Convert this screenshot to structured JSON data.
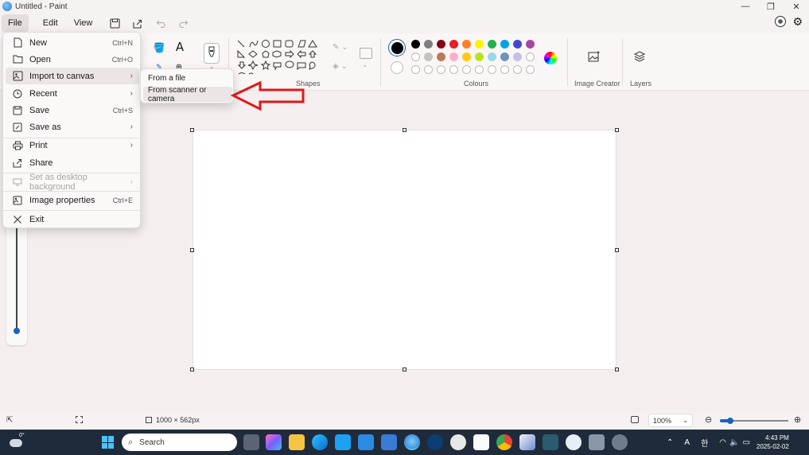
{
  "window": {
    "title": "Untitled - Paint"
  },
  "menubar": {
    "file": "File",
    "edit": "Edit",
    "view": "View"
  },
  "ribbon": {
    "shapes_label": "Shapes",
    "colours_label": "Colours",
    "image_creator_label": "Image Creator",
    "layers_label": "Layers",
    "palette_row1": [
      "#000000",
      "#7f7f7f",
      "#880015",
      "#ed1c24",
      "#ff7f27",
      "#fff200",
      "#22b14c",
      "#00a2e8",
      "#3f48cc",
      "#a349a4"
    ],
    "palette_row2": [
      "#ffffff",
      "#c3c3c3",
      "#b97a57",
      "#ffaec9",
      "#ffc90e",
      "#b5e61d",
      "#99d9ea",
      "#7092be",
      "#c8bfe7",
      "#ffffff"
    ],
    "primary_color": "#000000",
    "secondary_color": "#ffffff"
  },
  "file_menu": {
    "items": [
      {
        "label": "New",
        "shortcut": "Ctrl+N",
        "icon": "new-file-icon"
      },
      {
        "label": "Open",
        "shortcut": "Ctrl+O",
        "icon": "open-folder-icon"
      },
      {
        "label": "Import to canvas",
        "shortcut": "",
        "icon": "import-icon"
      },
      {
        "label": "Recent",
        "shortcut": "",
        "icon": "recent-icon"
      },
      {
        "label": "Save",
        "shortcut": "Ctrl+S",
        "icon": "save-icon"
      },
      {
        "label": "Save as",
        "shortcut": "",
        "icon": "save-as-icon"
      },
      {
        "label": "Print",
        "shortcut": "",
        "icon": "print-icon"
      },
      {
        "label": "Share",
        "shortcut": "",
        "icon": "share-icon"
      },
      {
        "label": "Set as desktop background",
        "shortcut": "",
        "icon": "desktop-background-icon"
      },
      {
        "label": "Image properties",
        "shortcut": "Ctrl+E",
        "icon": "image-properties-icon"
      },
      {
        "label": "Exit",
        "shortcut": "",
        "icon": "exit-icon"
      }
    ]
  },
  "import_submenu": {
    "items": [
      {
        "label": "From a file"
      },
      {
        "label": "From scanner or camera"
      }
    ]
  },
  "statusbar": {
    "canvas_size": "1000 × 562px",
    "zoom": "100%",
    "zoom_level": 0.15
  },
  "taskbar": {
    "search_placeholder": "Search",
    "weather": "0°",
    "time": "4:43 PM",
    "date": "2025-02-02",
    "ime": "A",
    "ime2": "한"
  }
}
